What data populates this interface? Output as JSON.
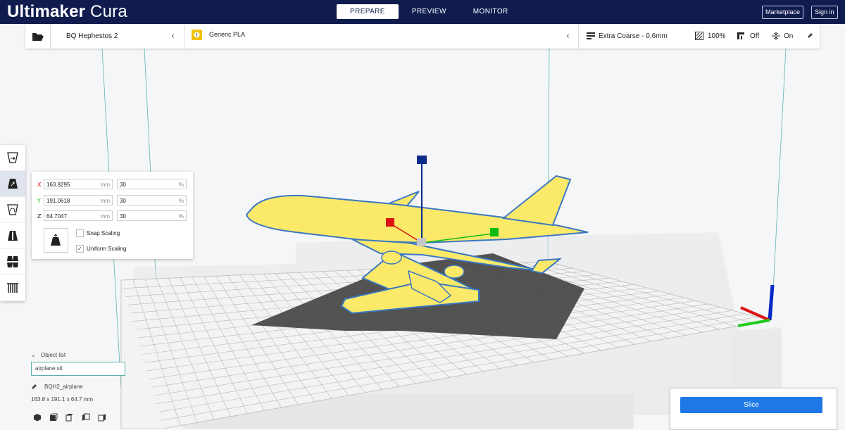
{
  "app": {
    "brand_bold": "Ultimaker",
    "brand_light": " Cura"
  },
  "stages": [
    "PREPARE",
    "PREVIEW",
    "MONITOR"
  ],
  "top_buttons": {
    "marketplace": "Marketplace",
    "signin": "Sign in"
  },
  "printer": {
    "name": "BQ Hephestos 2"
  },
  "material": {
    "name": "Generic PLA"
  },
  "settings": {
    "profile": "Extra Coarse - 0.6mm",
    "infill": "100%",
    "support": "Off",
    "adhesion": "On"
  },
  "scale_panel": {
    "x_label": "X",
    "y_label": "Y",
    "z_label": "Z",
    "x_mm": "163.8295",
    "y_mm": "191.0618",
    "z_mm": "64.7047",
    "x_pct": "30",
    "y_pct": "30",
    "z_pct": "30",
    "mm_unit": "mm",
    "pct_unit": "%",
    "snap_label": "Snap Scaling",
    "snap_checked": false,
    "uniform_label": "Uniform Scaling",
    "uniform_checked": true,
    "uniform_check_glyph": "✓"
  },
  "object_list": {
    "header": "Object list",
    "selected_file": "airplane.stl",
    "job_name": "BQH2_airplane",
    "dimensions": "163.8 x 191.1 x 64.7 mm"
  },
  "slice": {
    "label": "Slice"
  },
  "colors": {
    "topbar": "#101c4e",
    "accent": "#1e78e6",
    "model": "#fbe96a",
    "outline": "#3a78c2",
    "shadow": "#4a4a4a"
  }
}
